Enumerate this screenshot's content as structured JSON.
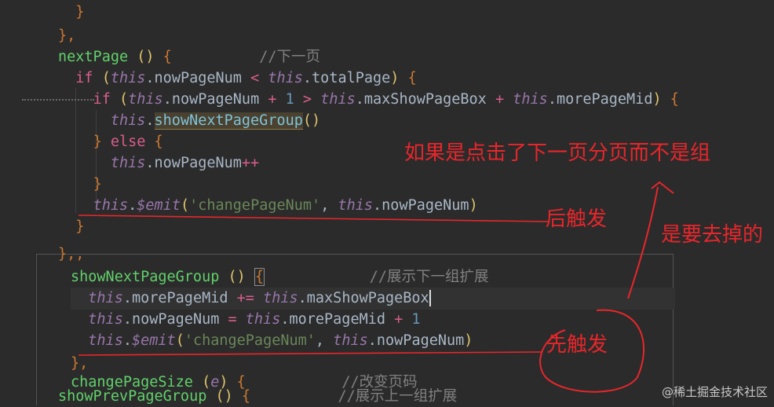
{
  "code": {
    "lines": [
      {
        "t": "    }"
      },
      {
        "t": "  },"
      },
      {
        "t": "  nextPage () {          //下一页"
      },
      {
        "t": "    if (this.nowPageNum < this.totalPage) {"
      },
      {
        "t": "      if (this.nowPageNum + 1 > this.maxShowPageBox + this.morePageMid) {"
      },
      {
        "t": "        this.showNextPageGroup()"
      },
      {
        "t": "      } else {"
      },
      {
        "t": "        this.nowPageNum++"
      },
      {
        "t": "      }"
      },
      {
        "t": "      this.$emit('changePageNum', this.nowPageNum)"
      },
      {
        "t": "    }"
      },
      {
        "t": "  },"
      },
      {
        "t": "  showNextPageGroup () {            //展示下一组扩展"
      },
      {
        "t": "    this.morePageMid += this.maxShowPageBox"
      },
      {
        "t": "    this.nowPageNum = this.morePageMid + 1"
      },
      {
        "t": "    this.$emit('changePageNum', this.nowPageNum)"
      },
      {
        "t": "  },"
      },
      {
        "t": "  changePageSize (e) {           //改变页码"
      },
      {
        "t": "  showPrevPageGroup () {          //展示上一组扩展"
      }
    ]
  },
  "annotations": {
    "note_top": "如果是点击了下一页分页而不是组",
    "note_later": "后触发",
    "note_remove": "是要去掉的",
    "note_first": "先触发"
  },
  "watermark": "@稀土掘金技术社区",
  "colors": {
    "background": "#2b2b2b",
    "keyword": "#cc7832",
    "this": "#9876aa",
    "string": "#6a8759",
    "number": "#6897bb",
    "comment": "#808080",
    "annotation": "#e8262b"
  }
}
